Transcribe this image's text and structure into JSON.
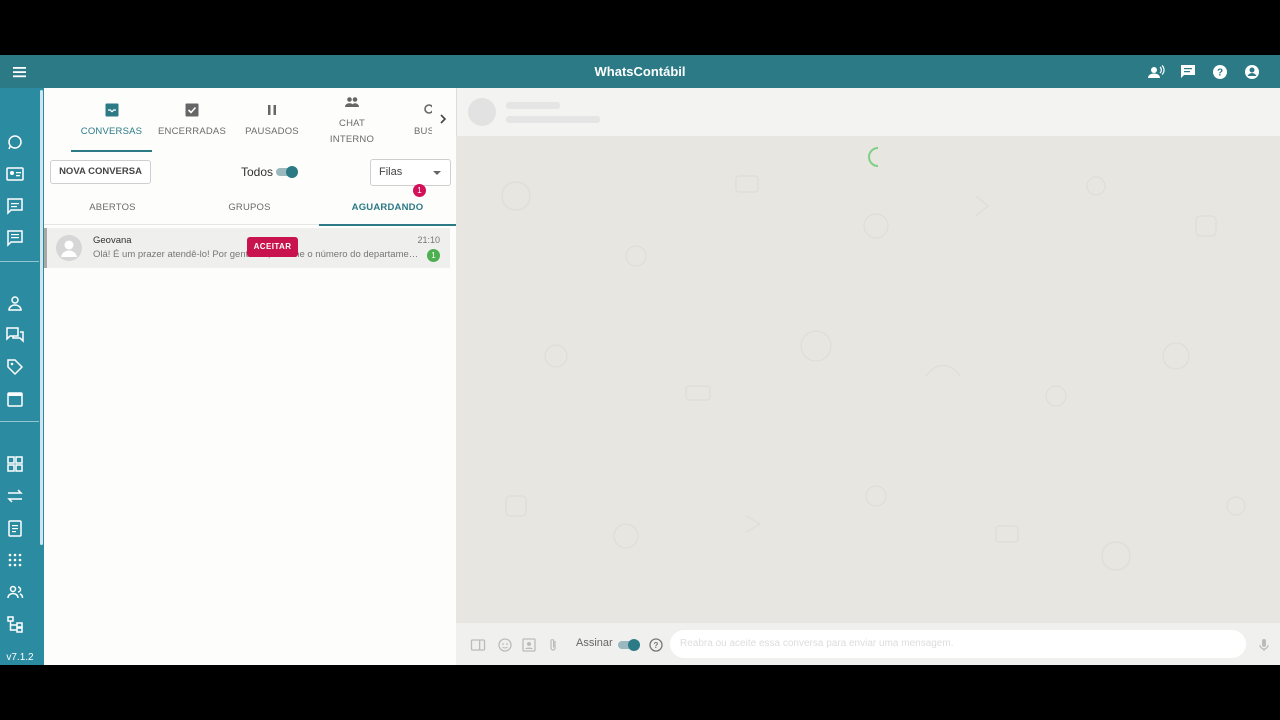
{
  "app": {
    "title": "WhatsContábil",
    "version": "v7.1.2",
    "accent_color": "#2b7a86",
    "rail_color": "#2b8ba0"
  },
  "topbar_icons": [
    "menu-icon",
    "users-voice-icon",
    "chat-icon",
    "help-icon",
    "account-icon"
  ],
  "rail": {
    "items": [
      "whatsapp-icon",
      "contact-card-icon",
      "message-icon",
      "chat-list-icon",
      "person-icon",
      "forum-icon",
      "tag-icon",
      "calendar-icon",
      "dashboard-icon",
      "swap-icon",
      "clipboard-icon",
      "grid-icon",
      "group-icon",
      "hierarchy-icon"
    ]
  },
  "tabs": [
    {
      "label": "CONVERSAS",
      "icon": "inbox-icon",
      "active": true
    },
    {
      "label": "ENCERRADAS",
      "icon": "checkbox-icon",
      "active": false
    },
    {
      "label": "PAUSADOS",
      "icon": "pause-icon",
      "active": false
    },
    {
      "label": "CHAT INTERNO",
      "icon": "people-icon",
      "active": false
    },
    {
      "label": "BUS",
      "icon": "search-icon",
      "active": false
    }
  ],
  "toolbar": {
    "new_conversation": "NOVA CONVERSA",
    "all_label": "Todos",
    "all_enabled": true,
    "queues_label": "Filas"
  },
  "subtabs": [
    {
      "label": "ABERTOS",
      "active": false
    },
    {
      "label": "GRUPOS",
      "active": false
    },
    {
      "label": "AGUARDANDO",
      "active": true,
      "badge": "1"
    }
  ],
  "conversations": [
    {
      "name": "Geovana",
      "time": "21:10",
      "message": "Olá! É um prazer atendê-lo! Por gentileza, informe o número do departamento",
      "unread": "1",
      "accept_label": "ACEITAR"
    }
  ],
  "composer": {
    "sign_label": "Assinar",
    "sign_enabled": true,
    "placeholder": "Reabra ou aceite essa conversa para enviar uma mensagem."
  }
}
